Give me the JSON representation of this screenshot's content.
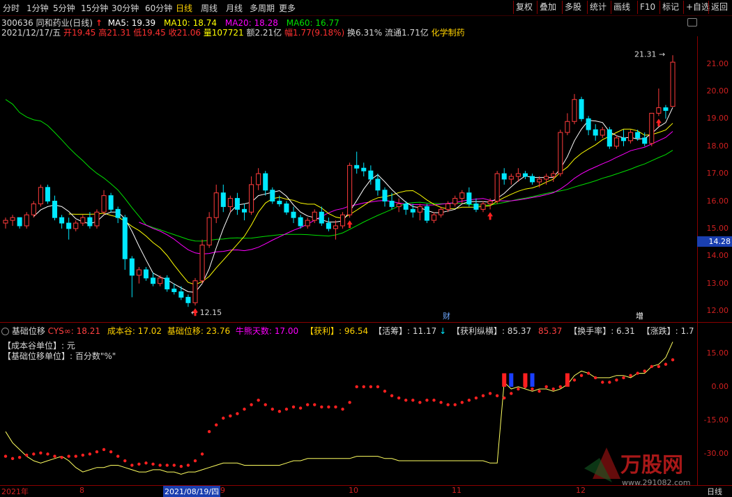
{
  "toolbar": {
    "periods": [
      "分时",
      "1分钟",
      "5分钟",
      "15分钟",
      "30分钟",
      "60分钟",
      "日线",
      "周线",
      "月线",
      "多周期",
      "更多"
    ],
    "active_period": "日线",
    "right_buttons": [
      "复权",
      "叠加",
      "多股",
      "统计",
      "画线",
      "F10",
      "标记",
      "+自选",
      "返回"
    ]
  },
  "stock": {
    "code_name": "300636 同和药业(日线)",
    "ma5": "MA5: 19.39",
    "ma10": "MA10: 18.74",
    "ma20": "MA20: 18.28",
    "ma60": "MA60: 16.77",
    "date": "2021/12/17/五",
    "open": "开19.45",
    "high": "高21.31",
    "low": "低19.45",
    "close": "收21.06",
    "volume": "量107721",
    "amount": "额2.21亿",
    "change": "幅1.77(9.18%)",
    "turnover": "换6.31%",
    "float": "流通1.71亿",
    "sector": "化学制药"
  },
  "main_chart": {
    "y_ticks": [
      "21.00",
      "20.00",
      "19.00",
      "18.00",
      "17.00",
      "16.00",
      "15.00",
      "14.00",
      "13.00",
      "12.00"
    ],
    "y_range": [
      11.8,
      21.8
    ],
    "current_price_label": "14.28",
    "high_annotation": "21.31",
    "low_annotation": "12.15",
    "markers": [
      "财",
      "增"
    ]
  },
  "indicator": {
    "name": "基础位移",
    "cys": "CYS∞: 18.21",
    "cost_valley": "成本谷: 17.02",
    "base_shift": "基础位移: 23.76",
    "bull_days": "牛熊天数: 17.00",
    "profit": "【获利】: 96.54",
    "active_chips": "【活筹】: 11.17",
    "profit_span": "【获利纵横】: 85.37",
    "profit_span2": "85.37",
    "turnover": "【换手率】: 6.31",
    "change": "【涨跌】: 1.7",
    "note1": "【成本谷单位】: 元",
    "note2": "【基础位移单位】: 百分数\"%\"",
    "y_ticks": [
      "15.00",
      "0.00",
      "-15.00",
      "-30.00"
    ]
  },
  "dates": [
    "2021年",
    "8",
    "2021/08/19/四",
    "9",
    "10",
    "11",
    "12",
    "日线"
  ],
  "watermark": {
    "brand": "万股网",
    "url": "www.291082.com"
  },
  "colors": {
    "up": "#ff3c3c",
    "down": "#00e8ff",
    "ma5": "#ffffff",
    "ma10": "#ffff00",
    "ma20": "#ff00ff",
    "ma60": "#00e000"
  },
  "chart_data": {
    "type": "candlestick",
    "candles": [
      [
        15.2,
        15.4,
        15.0,
        15.3
      ],
      [
        15.3,
        15.5,
        15.1,
        15.4
      ],
      [
        15.4,
        15.4,
        15.0,
        15.1
      ],
      [
        15.1,
        15.6,
        15.0,
        15.5
      ],
      [
        15.5,
        16.0,
        15.4,
        15.9
      ],
      [
        15.9,
        16.6,
        15.8,
        16.5
      ],
      [
        16.5,
        16.6,
        15.9,
        16.0
      ],
      [
        16.0,
        16.2,
        15.3,
        15.4
      ],
      [
        15.4,
        15.5,
        15.0,
        15.2
      ],
      [
        15.2,
        15.4,
        14.6,
        15.0
      ],
      [
        15.0,
        15.3,
        14.9,
        15.2
      ],
      [
        15.2,
        15.5,
        15.1,
        15.4
      ],
      [
        15.4,
        15.6,
        15.0,
        15.1
      ],
      [
        15.1,
        15.7,
        15.0,
        15.6
      ],
      [
        15.6,
        16.4,
        15.5,
        16.2
      ],
      [
        16.2,
        16.3,
        15.6,
        15.7
      ],
      [
        15.7,
        15.8,
        15.2,
        15.4
      ],
      [
        15.4,
        15.5,
        13.5,
        13.9
      ],
      [
        13.9,
        14.0,
        12.5,
        13.3
      ],
      [
        13.3,
        13.6,
        13.0,
        13.5
      ],
      [
        13.5,
        13.6,
        13.1,
        13.2
      ],
      [
        13.2,
        13.4,
        12.9,
        13.0
      ],
      [
        13.0,
        13.3,
        12.9,
        13.2
      ],
      [
        13.2,
        13.3,
        12.7,
        12.8
      ],
      [
        12.8,
        13.0,
        12.6,
        12.7
      ],
      [
        12.7,
        12.9,
        12.4,
        12.5
      ],
      [
        12.5,
        12.6,
        12.15,
        12.3
      ],
      [
        12.3,
        13.2,
        12.2,
        13.1
      ],
      [
        13.1,
        14.6,
        13.0,
        14.4
      ],
      [
        14.4,
        15.6,
        14.3,
        15.4
      ],
      [
        15.4,
        16.6,
        15.2,
        16.3
      ],
      [
        16.3,
        16.6,
        15.6,
        15.8
      ],
      [
        15.8,
        16.2,
        15.6,
        16.1
      ],
      [
        16.1,
        16.3,
        15.5,
        15.7
      ],
      [
        15.7,
        15.9,
        15.3,
        15.6
      ],
      [
        15.6,
        16.9,
        15.5,
        16.6
      ],
      [
        16.6,
        17.2,
        16.4,
        17.0
      ],
      [
        17.0,
        17.1,
        16.2,
        16.4
      ],
      [
        16.4,
        16.5,
        15.9,
        16.0
      ],
      [
        16.0,
        16.2,
        15.8,
        15.9
      ],
      [
        15.9,
        16.0,
        15.5,
        15.6
      ],
      [
        15.6,
        15.8,
        15.2,
        15.4
      ],
      [
        15.4,
        15.5,
        15.0,
        15.1
      ],
      [
        15.1,
        15.4,
        15.0,
        15.3
      ],
      [
        15.3,
        15.7,
        15.2,
        15.6
      ],
      [
        15.6,
        15.8,
        15.1,
        15.2
      ],
      [
        15.2,
        15.4,
        14.9,
        15.0
      ],
      [
        15.0,
        15.3,
        14.6,
        15.1
      ],
      [
        15.1,
        15.6,
        15.0,
        15.5
      ],
      [
        15.5,
        17.4,
        15.4,
        17.3
      ],
      [
        17.3,
        17.8,
        17.0,
        17.2
      ],
      [
        17.2,
        17.4,
        16.9,
        17.1
      ],
      [
        17.1,
        17.3,
        16.6,
        16.8
      ],
      [
        16.8,
        17.0,
        16.2,
        16.4
      ],
      [
        16.4,
        16.5,
        15.8,
        16.0
      ],
      [
        16.0,
        16.3,
        15.7,
        15.8
      ],
      [
        15.8,
        16.1,
        15.6,
        15.9
      ],
      [
        15.9,
        16.0,
        15.5,
        15.7
      ],
      [
        15.7,
        15.9,
        15.4,
        15.6
      ],
      [
        15.6,
        15.9,
        15.3,
        15.8
      ],
      [
        15.8,
        15.9,
        15.2,
        15.3
      ],
      [
        15.3,
        15.6,
        15.2,
        15.5
      ],
      [
        15.5,
        15.8,
        15.4,
        15.7
      ],
      [
        15.7,
        16.0,
        15.6,
        15.9
      ],
      [
        15.9,
        16.2,
        15.8,
        16.1
      ],
      [
        16.1,
        16.4,
        15.9,
        16.3
      ],
      [
        16.3,
        16.5,
        15.8,
        15.9
      ],
      [
        15.9,
        16.1,
        15.6,
        15.7
      ],
      [
        15.7,
        16.0,
        15.6,
        15.9
      ],
      [
        15.9,
        16.1,
        15.7,
        16.0
      ],
      [
        16.0,
        17.1,
        15.9,
        17.0
      ],
      [
        17.0,
        17.2,
        16.6,
        16.8
      ],
      [
        16.8,
        17.0,
        16.6,
        16.9
      ],
      [
        16.9,
        17.2,
        16.7,
        17.0
      ],
      [
        17.0,
        17.1,
        16.8,
        16.9
      ],
      [
        16.9,
        17.0,
        16.6,
        16.7
      ],
      [
        16.7,
        16.9,
        16.5,
        16.8
      ],
      [
        16.8,
        17.0,
        16.6,
        16.9
      ],
      [
        16.9,
        17.1,
        16.7,
        17.0
      ],
      [
        17.0,
        18.6,
        16.9,
        18.5
      ],
      [
        18.5,
        19.2,
        18.4,
        18.9
      ],
      [
        18.9,
        19.9,
        18.8,
        19.7
      ],
      [
        19.7,
        19.8,
        18.9,
        19.0
      ],
      [
        19.0,
        19.1,
        18.4,
        18.6
      ],
      [
        18.6,
        18.8,
        18.2,
        18.4
      ],
      [
        18.4,
        18.7,
        18.3,
        18.6
      ],
      [
        18.6,
        18.7,
        17.9,
        18.0
      ],
      [
        18.0,
        18.4,
        17.9,
        18.3
      ],
      [
        18.3,
        18.6,
        18.0,
        18.2
      ],
      [
        18.2,
        18.6,
        18.1,
        18.5
      ],
      [
        18.5,
        18.6,
        18.2,
        18.3
      ],
      [
        18.3,
        18.5,
        18.0,
        18.1
      ],
      [
        18.1,
        19.2,
        18.0,
        19.2
      ],
      [
        19.2,
        20.1,
        19.1,
        19.4
      ],
      [
        19.4,
        19.5,
        19.0,
        19.3
      ],
      [
        19.45,
        21.31,
        19.45,
        21.06
      ]
    ],
    "indicator_dots": [
      -31,
      -32,
      -31.5,
      -30.5,
      -30,
      -29.5,
      -30,
      -31,
      -31.5,
      -31,
      -31,
      -30.5,
      -30,
      -29,
      -28,
      -29,
      -31,
      -33,
      -35,
      -34.5,
      -34,
      -34.5,
      -35,
      -35,
      -35,
      -35.5,
      -35,
      -33,
      -30,
      -20,
      -17,
      -14,
      -13,
      -12,
      -10,
      -8,
      -6,
      -8,
      -10,
      -11,
      -10,
      -9,
      -9.5,
      -8,
      -8,
      -9,
      -9,
      -9,
      -10,
      -7,
      0,
      0,
      0,
      0,
      -2,
      -4,
      -5,
      -6,
      -6,
      -7,
      -6,
      -6,
      -7,
      -8,
      -8,
      -7,
      -6,
      -5,
      -4,
      -3,
      -4,
      -5,
      -3,
      -1,
      0,
      -1,
      -2,
      0,
      -1,
      0,
      1,
      3,
      5,
      6,
      4,
      2,
      2,
      3,
      4,
      5,
      6,
      7,
      9,
      9,
      10,
      12
    ],
    "indicator_line": [
      -20,
      -25,
      -28,
      -31,
      -33,
      -34,
      -33,
      -32,
      -31,
      -33,
      -36,
      -38,
      -37,
      -36,
      -36,
      -35,
      -35,
      -36,
      -37,
      -38,
      -38,
      -37,
      -37,
      -38,
      -38,
      -39,
      -38,
      -38,
      -37,
      -36,
      -35,
      -34,
      -34,
      -34,
      -35,
      -35,
      -35,
      -35,
      -35,
      -35,
      -34,
      -33,
      -33,
      -32,
      -32,
      -32,
      -32,
      -32,
      -32,
      -32,
      -31,
      -31,
      -31,
      -31,
      -32,
      -32,
      -33,
      -33,
      -33,
      -33,
      -33,
      -33,
      -33,
      -33,
      -33,
      -33,
      -33,
      -33,
      -33,
      -34,
      -34,
      2,
      -1,
      0,
      -1,
      -2,
      -1,
      -1,
      -2,
      -1,
      1,
      5,
      7,
      6,
      4,
      4,
      4,
      5,
      5,
      4,
      6,
      6,
      9,
      10,
      13,
      20
    ]
  }
}
